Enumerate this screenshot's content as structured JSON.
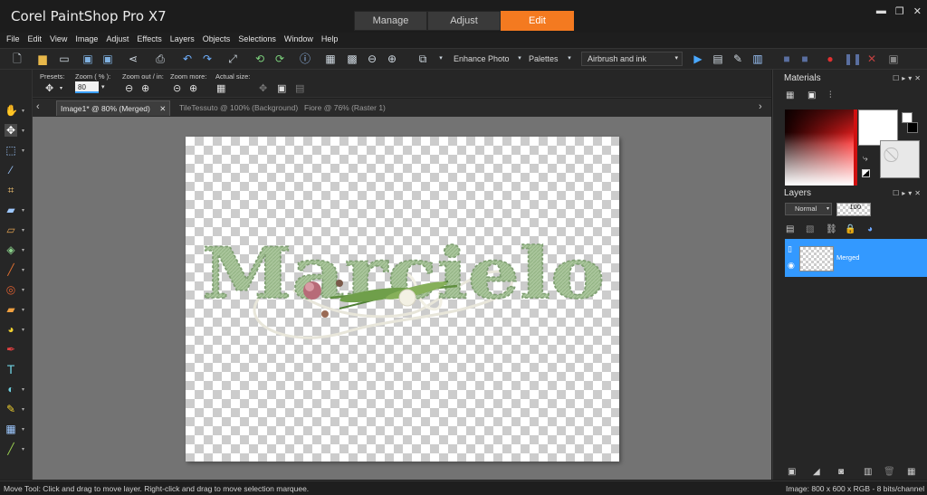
{
  "app": {
    "title": "Corel PaintShop Pro X7",
    "workspace_tabs": [
      {
        "label": "Manage",
        "active": false
      },
      {
        "label": "Adjust",
        "active": false
      },
      {
        "label": "Edit",
        "active": true
      }
    ],
    "accent_color": "#f47a20"
  },
  "menu": [
    "File",
    "Edit",
    "View",
    "Image",
    "Adjust",
    "Effects",
    "Layers",
    "Objects",
    "Selections",
    "Window",
    "Help"
  ],
  "toolbar": {
    "enhance_photo": "Enhance Photo",
    "palettes": "Palettes",
    "workspace_dropdown": "Airbrush and ink"
  },
  "tool_options": {
    "presets_label": "Presets:",
    "zoom_label": "Zoom ( % ):",
    "zoom_value": "80",
    "zoom_out_in_label": "Zoom out / in:",
    "zoom_more_label": "Zoom more:",
    "actual_size_label": "Actual size:"
  },
  "document_tabs": [
    {
      "label": "Image1* @  80% (Merged)",
      "active": true
    },
    {
      "label": "TileTessuto @ 100% (Background)",
      "active": false
    },
    {
      "label": "Fiore @  76% (Raster 1)",
      "active": false
    }
  ],
  "canvas": {
    "artwork_text": "Marcielo",
    "text_color": "#a8c49a"
  },
  "materials": {
    "title": "Materials",
    "foreground": "#ffffff",
    "background": "#e8e8e8"
  },
  "layers": {
    "title": "Layers",
    "blend_mode": "Normal",
    "opacity": "100",
    "items": [
      {
        "name": "Merged",
        "selected": true
      }
    ],
    "selection_color": "#3399ff"
  },
  "status": {
    "left": "Move Tool: Click and drag to move layer. Right-click and drag to move selection marquee.",
    "right": "Image:  800 x 600 x RGB - 8 bits/channel"
  }
}
